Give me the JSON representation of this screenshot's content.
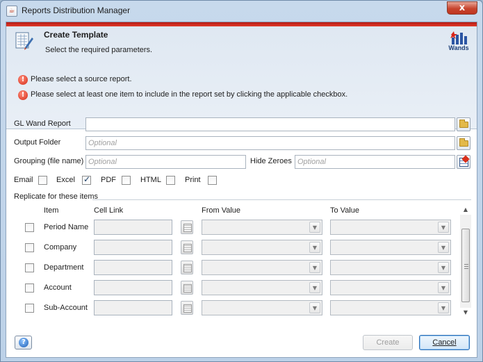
{
  "window": {
    "title": "Reports Distribution Manager",
    "close_glyph": "x"
  },
  "header": {
    "title": "Create Template",
    "subtitle": "Select the required parameters.",
    "logo_text": "Wands",
    "errors": [
      "Please select a source report.",
      "Please select at least one item to include in the report set by clicking the applicable checkbox."
    ]
  },
  "form": {
    "gl_wand_report": {
      "label": "GL Wand Report",
      "value": "",
      "placeholder": ""
    },
    "output_folder": {
      "label": "Output Folder",
      "value": "",
      "placeholder": "Optional"
    },
    "grouping": {
      "label": "Grouping (file name)",
      "value": "",
      "placeholder": "Optional"
    },
    "hide_zeroes": {
      "label": "Hide Zeroes",
      "value": "",
      "placeholder": "Optional"
    },
    "formats": [
      {
        "label": "Email",
        "checked": false
      },
      {
        "label": "Excel",
        "checked": true
      },
      {
        "label": "PDF",
        "checked": false
      },
      {
        "label": "HTML",
        "checked": false
      },
      {
        "label": "Print",
        "checked": false
      }
    ]
  },
  "replicate": {
    "section_label": "Replicate for these items",
    "columns": {
      "item": "Item",
      "cell_link": "Cell Link",
      "from_value": "From Value",
      "to_value": "To Value"
    },
    "rows": [
      {
        "item": "Period Name",
        "checked": false
      },
      {
        "item": "Company",
        "checked": false
      },
      {
        "item": "Department",
        "checked": false
      },
      {
        "item": "Account",
        "checked": false
      },
      {
        "item": "Sub-Account",
        "checked": false
      }
    ]
  },
  "footer": {
    "create_label": "Create",
    "cancel_label": "Cancel"
  }
}
